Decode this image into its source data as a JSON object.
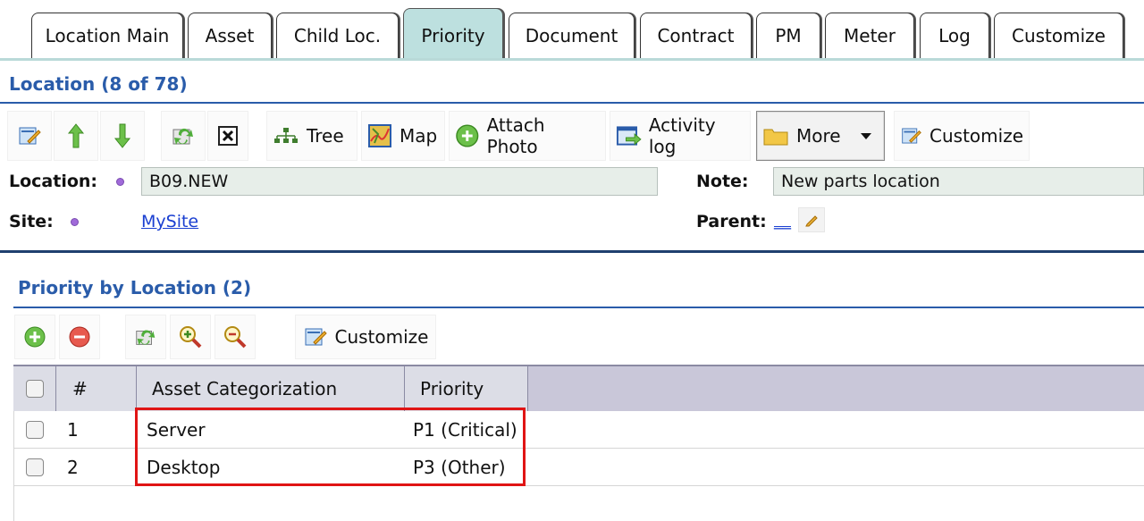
{
  "tabs": [
    {
      "label": "Location Main",
      "active": false
    },
    {
      "label": "Asset",
      "active": false
    },
    {
      "label": "Child Loc.",
      "active": false
    },
    {
      "label": "Priority",
      "active": true
    },
    {
      "label": "Document",
      "active": false
    },
    {
      "label": "Contract",
      "active": false
    },
    {
      "label": "PM",
      "active": false
    },
    {
      "label": "Meter",
      "active": false
    },
    {
      "label": "Log",
      "active": false
    },
    {
      "label": "Customize",
      "active": false
    }
  ],
  "location_header": {
    "title": "Location (8 of 78)"
  },
  "toolbar": {
    "tree_label": "Tree",
    "map_label": "Map",
    "attach_photo_label": "Attach Photo",
    "activity_log_label": "Activity log",
    "more_label": "More",
    "customize_label": "Customize"
  },
  "form": {
    "location_label": "Location:",
    "location_value": "B09.NEW",
    "note_label": "Note:",
    "note_value": "New parts location",
    "site_label": "Site:",
    "site_value": "MySite",
    "parent_label": "Parent:",
    "parent_value": "__"
  },
  "priority_section": {
    "title": "Priority by Location (2)",
    "customize_label": "Customize",
    "columns": [
      "#",
      "Asset Categorization",
      "Priority"
    ],
    "rows": [
      {
        "num": "1",
        "category": "Server",
        "priority": "P1 (Critical)"
      },
      {
        "num": "2",
        "category": "Desktop",
        "priority": "P3 (Other)"
      }
    ]
  },
  "colors": {
    "accent": "#2a5caa",
    "active_tab": "#bde0df",
    "highlight": "#e01515",
    "required_dot": "#a06ad9"
  }
}
